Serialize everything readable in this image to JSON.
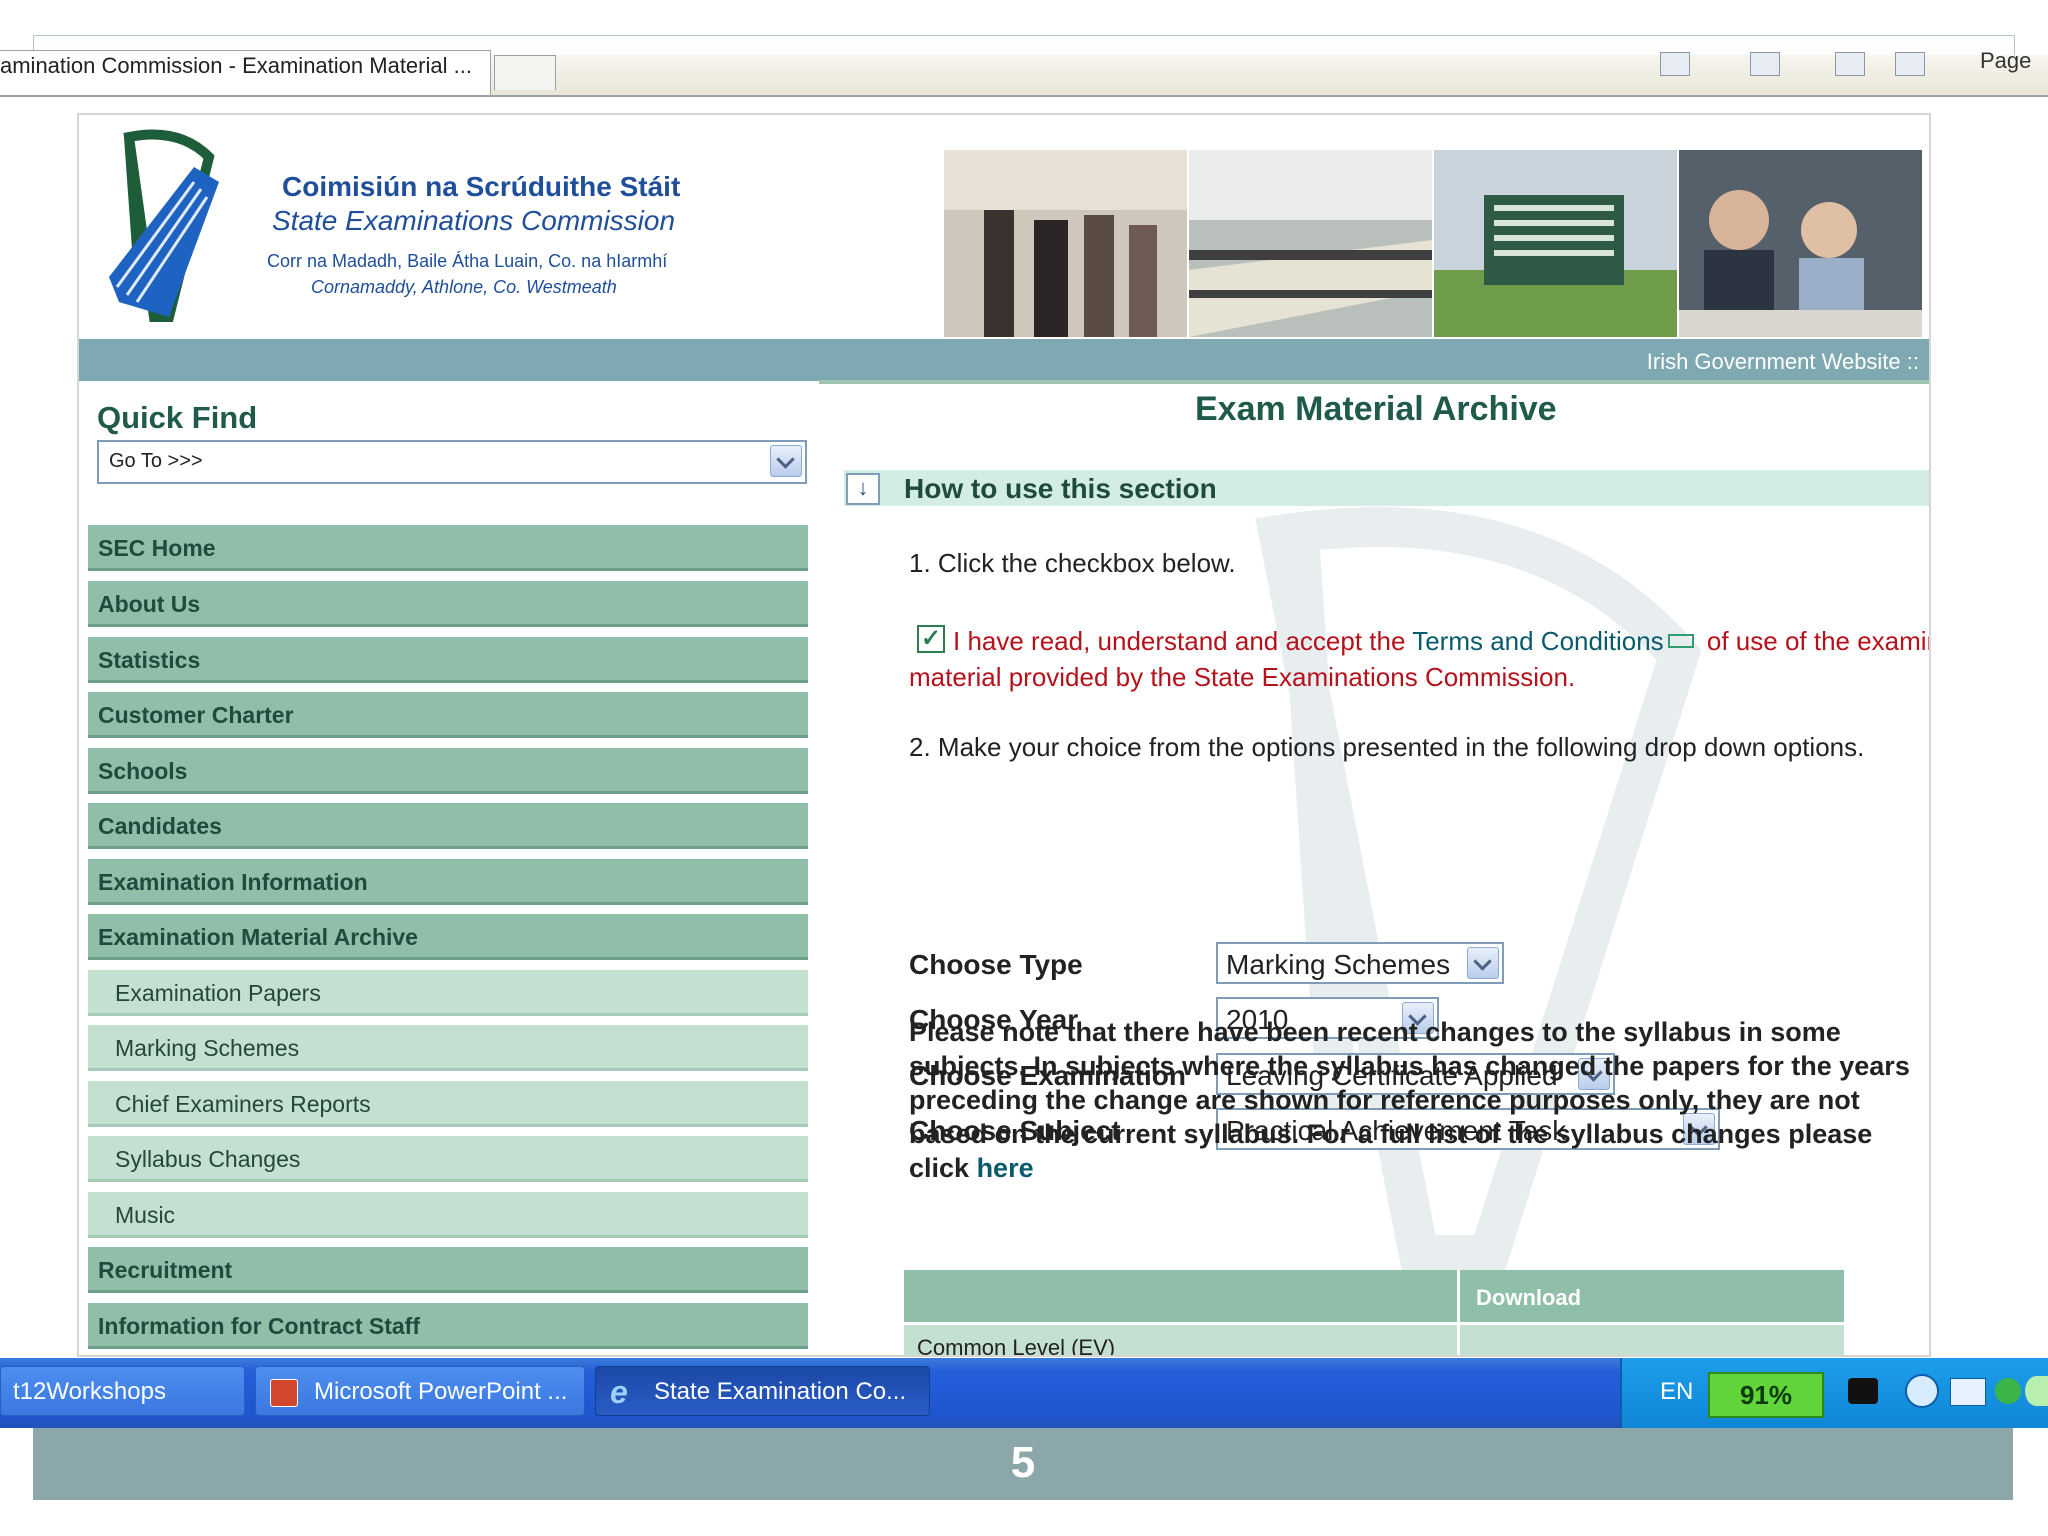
{
  "browser": {
    "tab_title": "amination Commission - Examination Material ...",
    "page_menu": "Page"
  },
  "header": {
    "org_name_irish": "Coimisiún na Scrúduithe Stáit",
    "org_name_english": "State Examinations Commission",
    "address_irish": "Corr na Madadh, Baile Átha Luain, Co. na hIarmhí",
    "address_english": "Cornamaddy, Athlone, Co. Westmeath",
    "gov_link": "Irish Government Website ::"
  },
  "sidebar": {
    "quick_find_title": "Quick Find",
    "goto_value": "Go To >>>",
    "items": [
      {
        "label": "SEC Home",
        "level": "top"
      },
      {
        "label": "About Us",
        "level": "top"
      },
      {
        "label": "Statistics",
        "level": "top"
      },
      {
        "label": "Customer Charter",
        "level": "top"
      },
      {
        "label": "Schools",
        "level": "top"
      },
      {
        "label": "Candidates",
        "level": "top"
      },
      {
        "label": "Examination Information",
        "level": "top"
      },
      {
        "label": "Examination Material Archive",
        "level": "top"
      },
      {
        "label": "Examination Papers",
        "level": "sub"
      },
      {
        "label": "Marking Schemes",
        "level": "sub"
      },
      {
        "label": "Chief Examiners Reports",
        "level": "sub"
      },
      {
        "label": "Syllabus Changes",
        "level": "sub"
      },
      {
        "label": "Music",
        "level": "sub"
      },
      {
        "label": "Recruitment",
        "level": "top"
      },
      {
        "label": "Information for Contract Staff",
        "level": "top"
      }
    ]
  },
  "main": {
    "title": "Exam Material Archive",
    "howto_label": "How to use this section",
    "howto_icon": "↓",
    "step1": "1. Click the checkbox below.",
    "terms_checked": true,
    "terms_prefix": "I have read, understand and accept the ",
    "terms_link": "Terms and Conditions",
    "terms_suffix": " of use of the examination material provided by the State Examinations Commission.",
    "step2": "2. Make your choice from the options presented in the following drop down options.",
    "form": {
      "type_label": "Choose Type",
      "type_value": "Marking Schemes",
      "year_label": "Choose Year",
      "year_value": "2010",
      "exam_label": "Choose Examination",
      "exam_value": "Leaving Certificate Applied",
      "subject_label": "Choose Subject",
      "subject_value": "Practical Achievement Task"
    },
    "note": "Please note that there have been recent changes to the syllabus in some subjects. In subjects where the syllabus has changed the papers for the years preceding the change are shown for reference purposes only, they are not based on the current syllabus. For a full list of the syllabus changes please click ",
    "note_link": "here",
    "table": {
      "download_header": "Download",
      "row_label": "Common Level (EV)"
    }
  },
  "taskbar": {
    "items": [
      "t12Workshops",
      "Microsoft PowerPoint ...",
      "State Examination Co..."
    ],
    "language": "EN",
    "battery": "91%"
  },
  "slide_number": "5",
  "colors": {
    "nav_top": "#8fbfa9",
    "nav_sub": "#c4e0d1",
    "band": "#7ea8b2",
    "terms_text": "#b5121b",
    "heading_green": "#1f5a4a",
    "taskbar_blue": "#245edb"
  }
}
